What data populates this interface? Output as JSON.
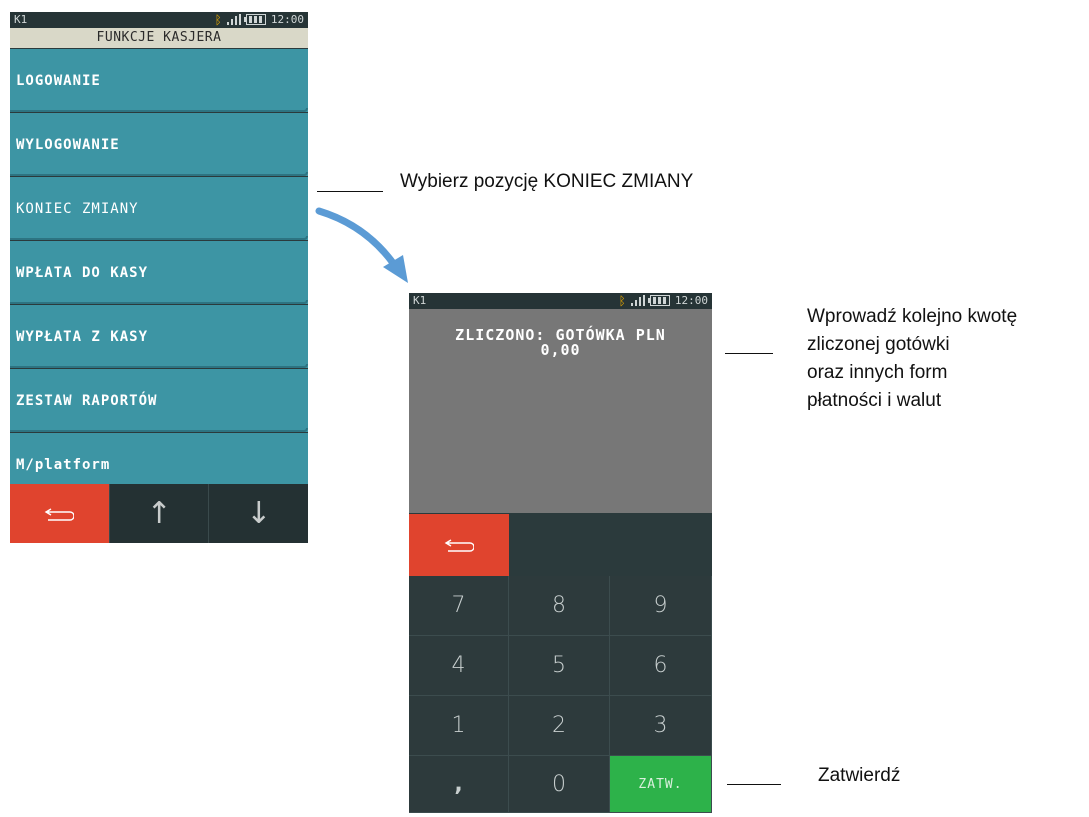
{
  "screen1": {
    "status": {
      "terminal": "K1",
      "time": "12:00"
    },
    "title": "FUNKCJE KASJERA",
    "menu": [
      {
        "label": "LOGOWANIE"
      },
      {
        "label": "WYLOGOWANIE"
      },
      {
        "label": "KONIEC ZMIANY"
      },
      {
        "label": "WPŁATA DO KASY"
      },
      {
        "label": "WYPŁATA Z KASY"
      },
      {
        "label": "ZESTAW RAPORTÓW"
      },
      {
        "label": "M/platform"
      }
    ],
    "nav": {
      "up": "↑",
      "down": "↓"
    }
  },
  "screen2": {
    "status": {
      "terminal": "K1",
      "time": "12:00"
    },
    "display": {
      "line1": "ZLICZONO: GOTÓWKA PLN",
      "line2": "0,00"
    },
    "keys": [
      "7",
      "8",
      "9",
      "4",
      "5",
      "6",
      "1",
      "2",
      "3",
      ",",
      "0",
      "ZATW."
    ]
  },
  "annotations": {
    "select": "Wybierz pozycję KONIEC ZMIANY",
    "enter": [
      "Wprowadź kolejno kwotę",
      "zliczonej gotówki",
      "oraz innych form",
      "płatności i walut"
    ],
    "confirm": "Zatwierdź"
  },
  "colors": {
    "menu": "#3d95a4",
    "back": "#e0442e",
    "confirm": "#2db24a",
    "arrow": "#5b9bd5"
  }
}
